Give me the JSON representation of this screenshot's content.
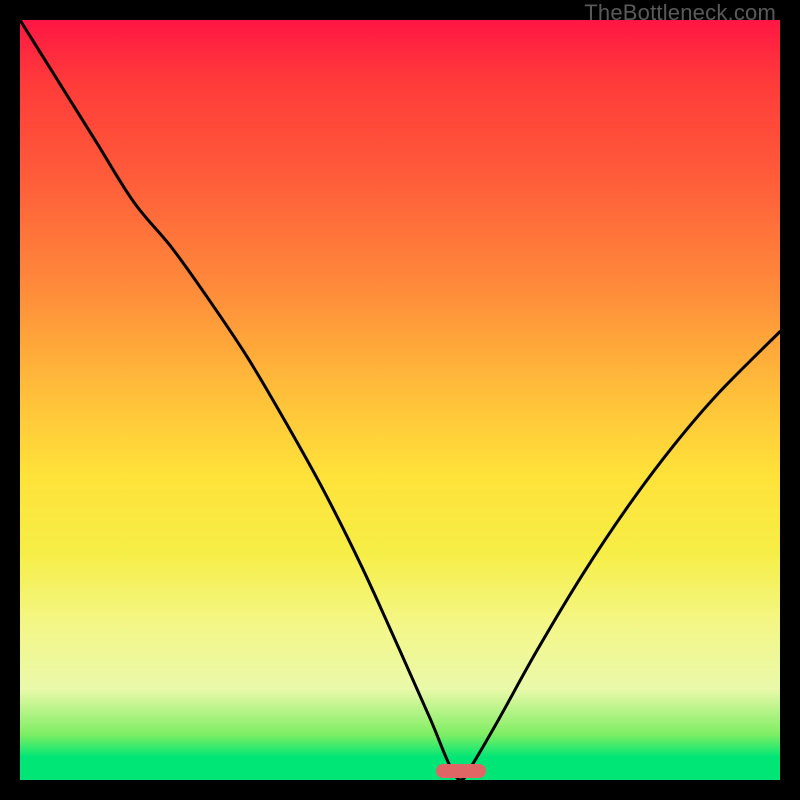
{
  "watermark": "TheBottleneck.com",
  "marker": {
    "x_frac": 0.58
  },
  "chart_data": {
    "type": "line",
    "title": "",
    "xlabel": "",
    "ylabel": "",
    "xlim": [
      0,
      1
    ],
    "ylim": [
      0,
      1
    ],
    "series": [
      {
        "name": "curve",
        "x": [
          0.0,
          0.05,
          0.1,
          0.15,
          0.2,
          0.25,
          0.3,
          0.35,
          0.4,
          0.45,
          0.5,
          0.54,
          0.565,
          0.58,
          0.595,
          0.63,
          0.68,
          0.74,
          0.8,
          0.86,
          0.92,
          1.0
        ],
        "values": [
          1.0,
          0.92,
          0.84,
          0.76,
          0.7,
          0.63,
          0.555,
          0.47,
          0.38,
          0.28,
          0.17,
          0.08,
          0.02,
          0.0,
          0.02,
          0.08,
          0.17,
          0.27,
          0.36,
          0.44,
          0.51,
          0.59
        ]
      }
    ],
    "background_gradient": [
      "#ff1744",
      "#ff8a3a",
      "#ffe23a",
      "#00e676"
    ],
    "bottom_marker_x_frac": 0.58
  }
}
